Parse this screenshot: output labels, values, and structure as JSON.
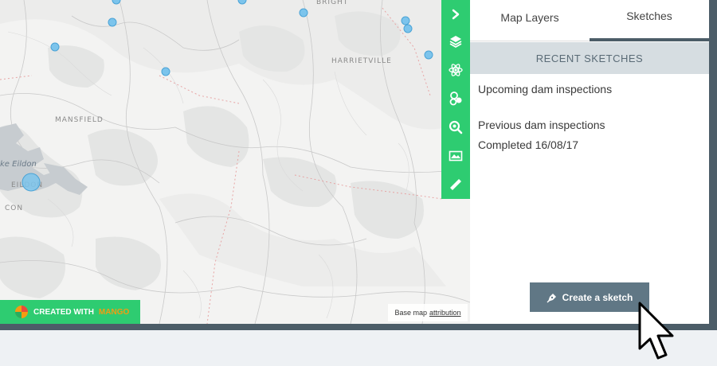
{
  "map": {
    "places": [
      {
        "name": "BRIGHT"
      },
      {
        "name": "HARRIETVILLE"
      },
      {
        "name": "MANSFIELD"
      },
      {
        "name": "EILDON"
      },
      {
        "name": "CON"
      }
    ],
    "lake_label": "ke Eildon",
    "marker_color": "#7cc4ec",
    "credit": {
      "prefix": "CREATED WITH",
      "brand": "MANGO"
    },
    "attribution": {
      "prefix": "Base map",
      "link": "attribution"
    }
  },
  "toolbar": {
    "accent": "#2ecc71",
    "tools": [
      {
        "icon": "chevron-right-icon"
      },
      {
        "icon": "layers-icon"
      },
      {
        "icon": "atom-icon"
      },
      {
        "icon": "circles-icon"
      },
      {
        "icon": "zoom-in-icon"
      },
      {
        "icon": "map-image-icon"
      },
      {
        "icon": "ruler-icon"
      }
    ]
  },
  "panel": {
    "tabs": [
      {
        "label": "Map Layers"
      },
      {
        "label": "Sketches"
      }
    ],
    "active_tab": "Sketches",
    "section_header": "RECENT SKETCHES",
    "sketches": [
      {
        "title": "Upcoming dam inspections"
      },
      {
        "title": "Previous dam inspections",
        "subtitle": "Completed 16/08/17"
      }
    ],
    "create_button": {
      "label": "Create a sketch",
      "icon": "pen-nib-icon"
    }
  }
}
